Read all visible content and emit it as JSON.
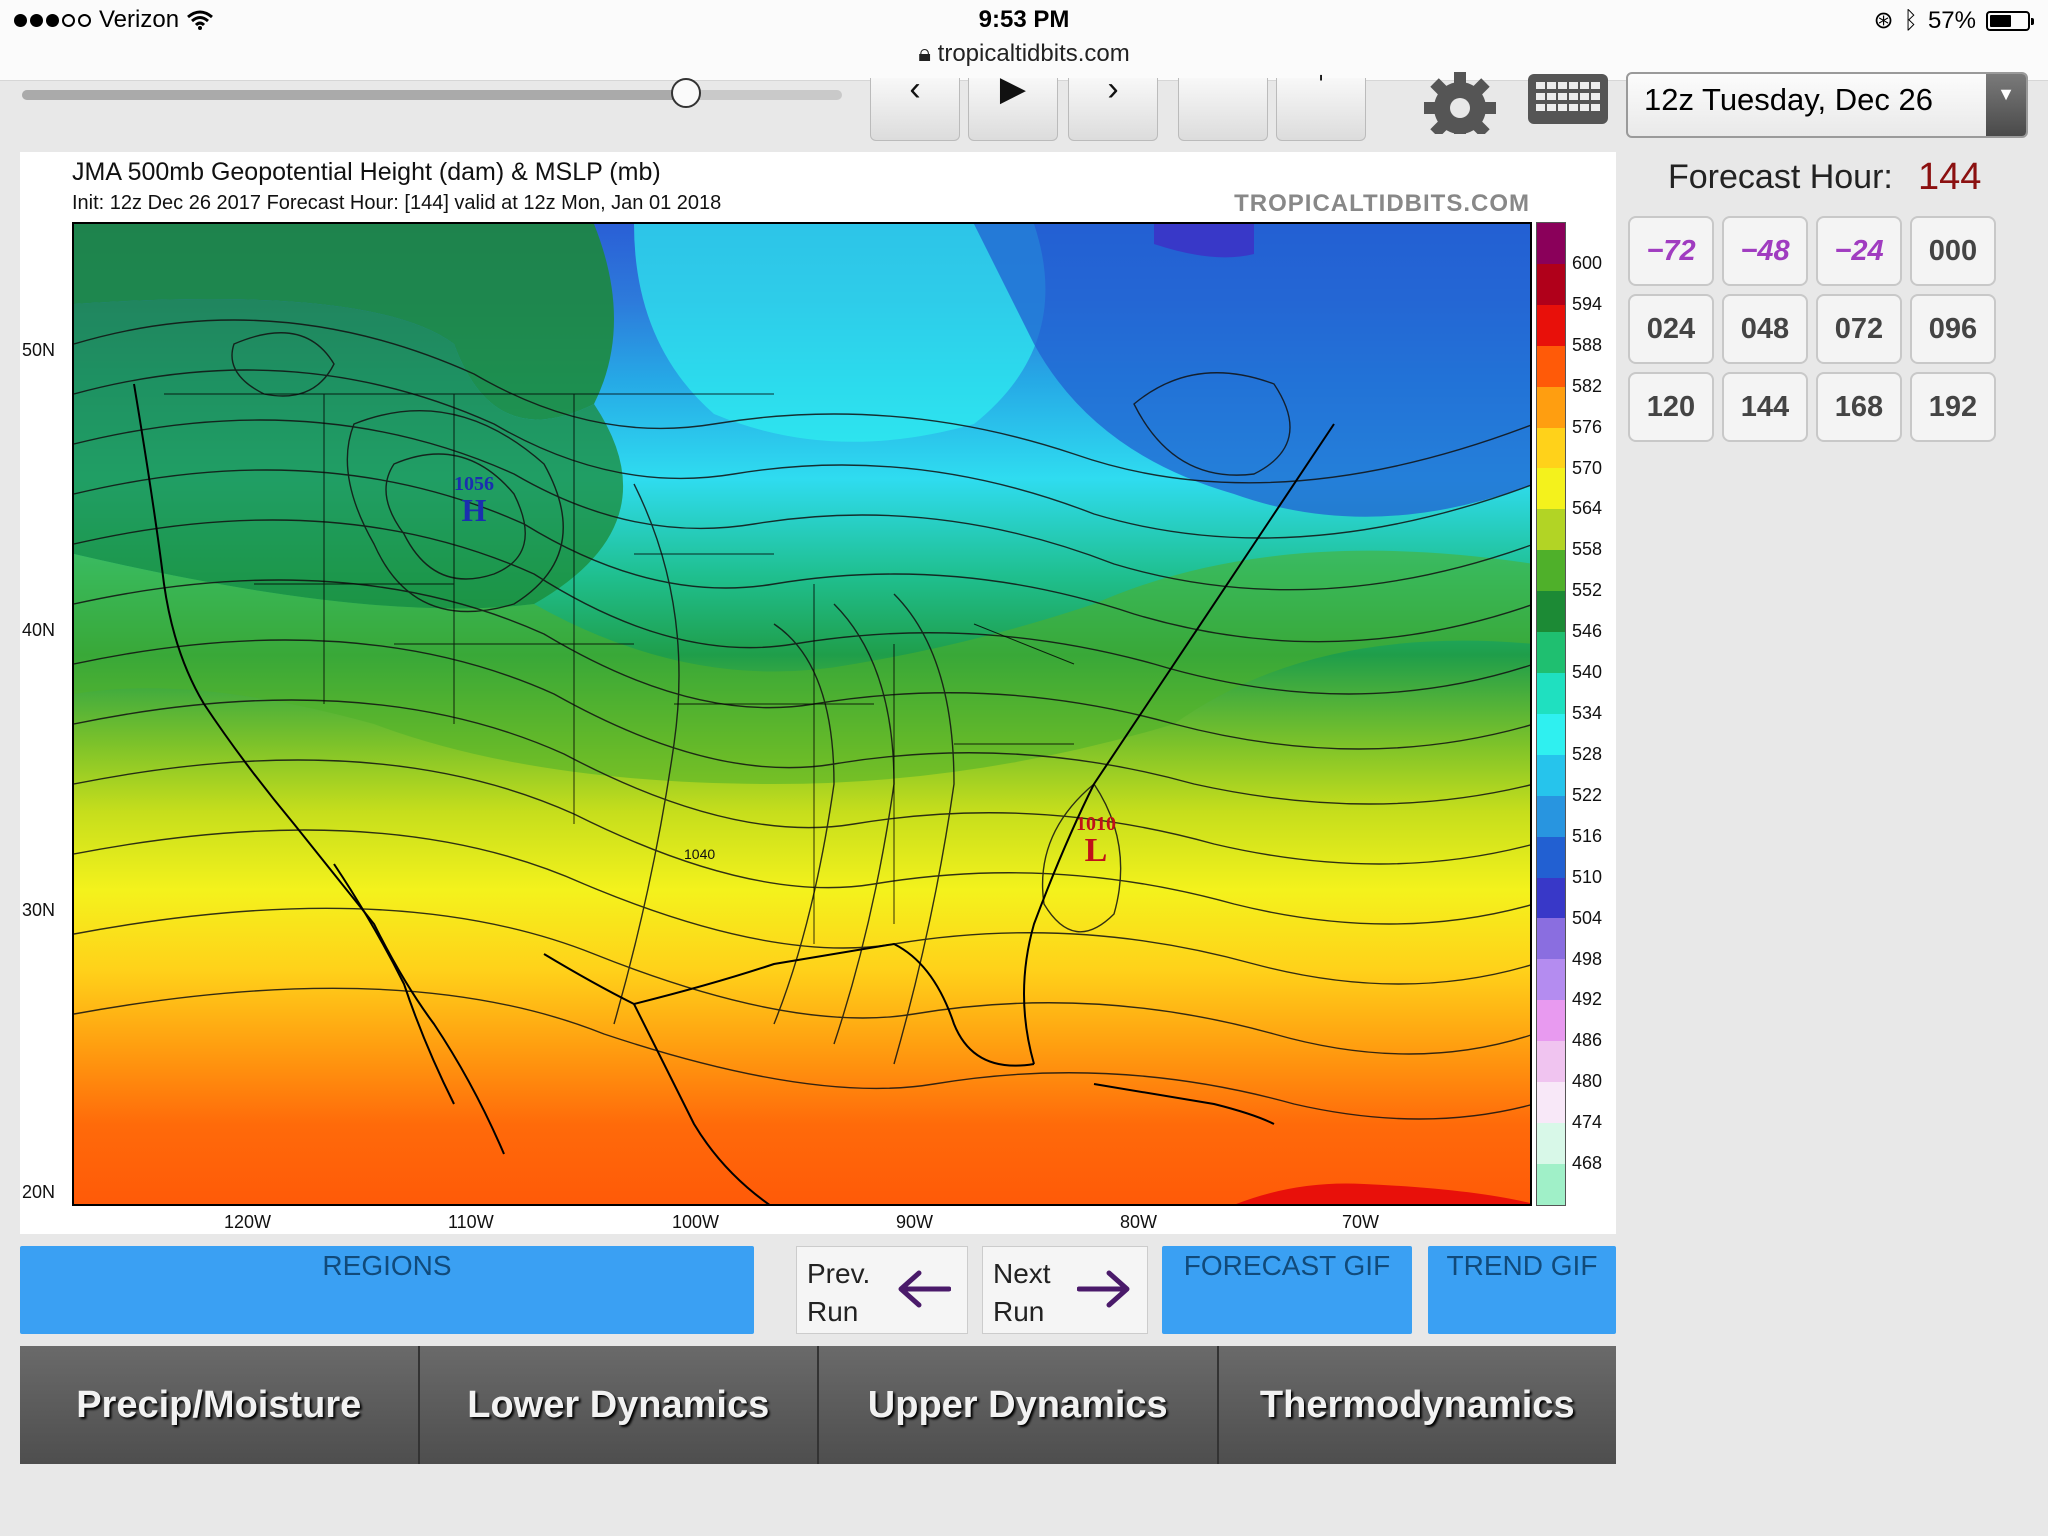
{
  "status": {
    "carrier": "Verizon",
    "time": "9:53 PM",
    "url": "tropicaltidbits.com",
    "battery": "57%",
    "battery_level": 0.57
  },
  "controls": {
    "slider_value": 0.81,
    "run_select": "12z Tuesday, Dec 26"
  },
  "map": {
    "title": "JMA 500mb Geopotential Height (dam) & MSLP (mb)",
    "subtitle": "Init: 12z Dec 26 2017   Forecast Hour: [144]   valid at 12z Mon, Jan 01 2018",
    "brand": "TROPICALTIDBITS.COM",
    "lat_labels": [
      "50N",
      "40N",
      "30N",
      "20N"
    ],
    "lon_labels": [
      "120W",
      "110W",
      "100W",
      "90W",
      "80W",
      "70W"
    ],
    "colorbar_labels": [
      "600",
      "594",
      "588",
      "582",
      "576",
      "570",
      "564",
      "558",
      "552",
      "546",
      "540",
      "534",
      "528",
      "522",
      "516",
      "510",
      "504",
      "498",
      "492",
      "486",
      "480",
      "474",
      "468"
    ],
    "colorbar_colors": [
      "#8a005a",
      "#b0001a",
      "#e8100a",
      "#ff5a08",
      "#ff9e10",
      "#ffd21a",
      "#f4f21c",
      "#b2d425",
      "#4fb02a",
      "#1c8a35",
      "#1fbf70",
      "#1fe0c0",
      "#2ff0f0",
      "#26c4ec",
      "#2895e0",
      "#2260d2",
      "#3838c8",
      "#8a6ee0",
      "#b48cf0",
      "#e89af0",
      "#f0c4f0",
      "#f8e8f8",
      "#d8f8e8",
      "#a0f0c8"
    ],
    "high_value": "1056",
    "high_letter": "H",
    "low_value": "1010",
    "low_letter": "L",
    "contour_label": "1040"
  },
  "forecast": {
    "label": "Forecast Hour:",
    "value": "144",
    "hours": [
      "−72",
      "−48",
      "−24",
      "000",
      "024",
      "048",
      "072",
      "096",
      "120",
      "144",
      "168",
      "192"
    ]
  },
  "nav": {
    "regions": "REGIONS",
    "prev_line1": "Prev.",
    "prev_line2": "Run",
    "next_line1": "Next",
    "next_line2": "Run",
    "forecast_gif": "FORECAST GIF",
    "trend_gif": "TREND GIF",
    "tabs": [
      "Precip/Moisture",
      "Lower Dynamics",
      "Upper Dynamics",
      "Thermodynamics"
    ]
  }
}
